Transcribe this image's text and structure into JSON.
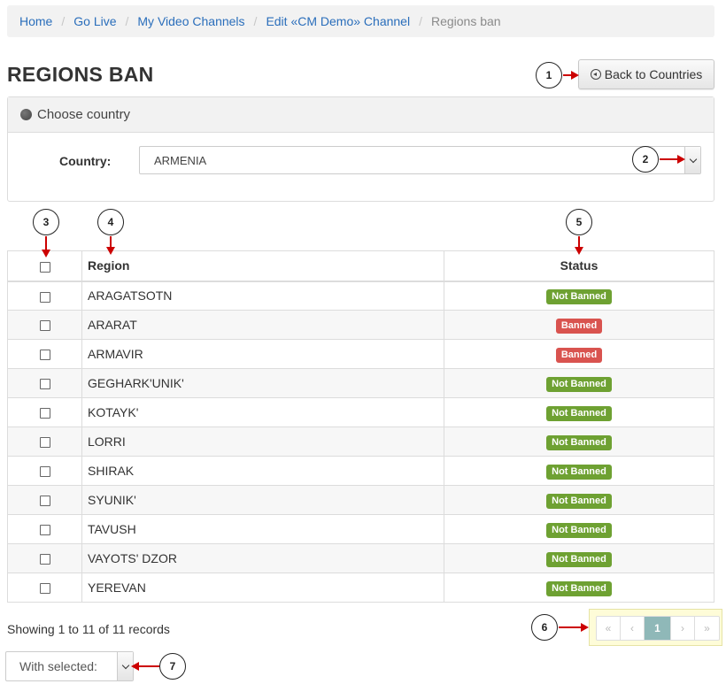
{
  "breadcrumb": {
    "items": [
      "Home",
      "Go Live",
      "My Video Channels",
      "Edit «CM Demo» Channel"
    ],
    "active": "Regions ban"
  },
  "page": {
    "title": "REGIONS BAN",
    "back_label": "Back to Countries"
  },
  "panel": {
    "title": "Choose country",
    "country_label": "Country:",
    "country_value": "ARMENIA"
  },
  "table": {
    "headers": {
      "region": "Region",
      "status": "Status"
    },
    "rows": [
      {
        "region": "ARAGATSOTN",
        "status": "Not Banned"
      },
      {
        "region": "ARARAT",
        "status": "Banned"
      },
      {
        "region": "ARMAVIR",
        "status": "Banned"
      },
      {
        "region": "GEGHARK'UNIK'",
        "status": "Not Banned"
      },
      {
        "region": "KOTAYK'",
        "status": "Not Banned"
      },
      {
        "region": "LORRI",
        "status": "Not Banned"
      },
      {
        "region": "SHIRAK",
        "status": "Not Banned"
      },
      {
        "region": "SYUNIK'",
        "status": "Not Banned"
      },
      {
        "region": "TAVUSH",
        "status": "Not Banned"
      },
      {
        "region": "VAYOTS' DZOR",
        "status": "Not Banned"
      },
      {
        "region": "YEREVAN",
        "status": "Not Banned"
      }
    ]
  },
  "footer": {
    "showing": "Showing 1 to 11 of 11 records",
    "with_selected": "With selected:"
  },
  "pagination": {
    "first": "«",
    "prev": "‹",
    "current": "1",
    "next": "›",
    "last": "»"
  },
  "callouts": [
    "1",
    "2",
    "3",
    "4",
    "5",
    "6",
    "7"
  ],
  "colors": {
    "not_banned": "#6ea132",
    "banned": "#d9534f",
    "link": "#2a6ebb",
    "annotation_arrow": "#cc0000",
    "pager_highlight": "#fefcd8"
  }
}
